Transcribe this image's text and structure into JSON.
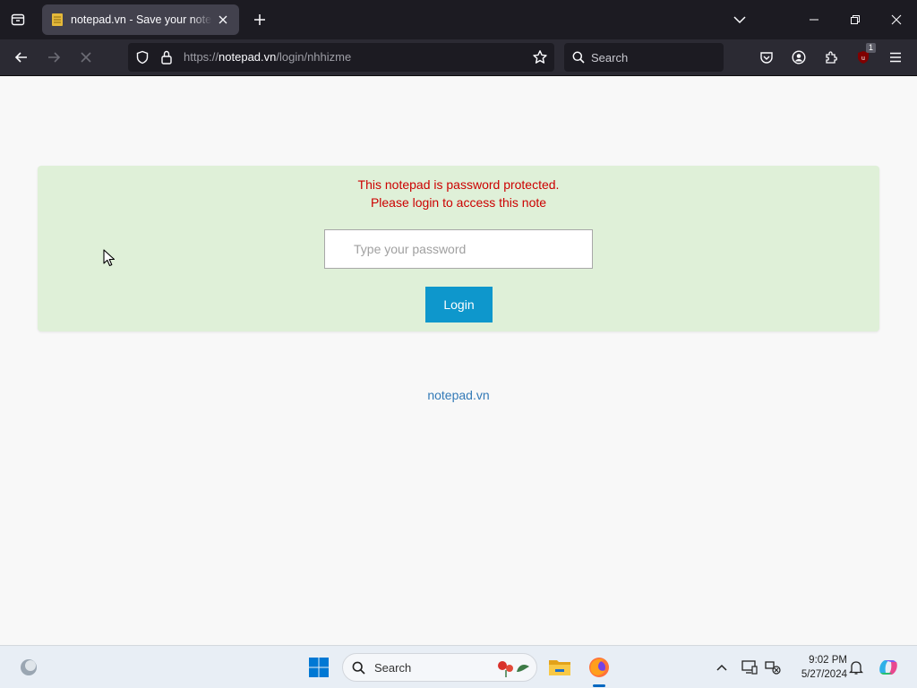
{
  "browser": {
    "tab": {
      "title": "notepad.vn - Save your notes, share your notes"
    },
    "urlbar": {
      "scheme": "https://",
      "domain": "notepad.vn",
      "path": "/login/nhhizme"
    },
    "searchbar": {
      "placeholder": "Search"
    },
    "extension_badge": "1"
  },
  "page": {
    "alert_line1": "This notepad is password protected.",
    "alert_line2": "Please login to access this note",
    "password_placeholder": "Type your password",
    "login_label": "Login",
    "footer_link": "notepad.vn"
  },
  "taskbar": {
    "search_label": "Search",
    "time": "9:02 PM",
    "date": "5/27/2024"
  },
  "colors": {
    "alert_bg": "#dff0d8",
    "alert_text": "#cc0000",
    "login_button": "#0e97cc",
    "link": "#337ab7",
    "chrome_dark": "#1c1b22"
  }
}
